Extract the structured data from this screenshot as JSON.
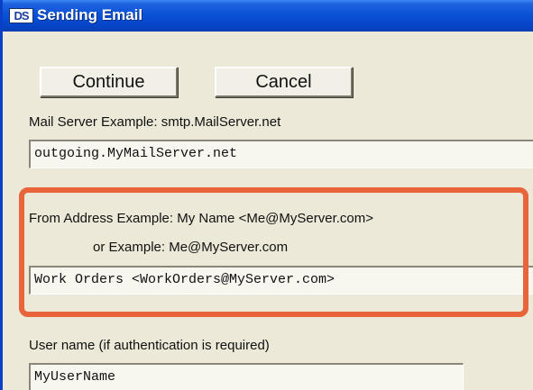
{
  "window": {
    "title": "Sending Email",
    "icon_text": "DS",
    "icon": "app-icon"
  },
  "buttons": {
    "continue_label": "Continue",
    "cancel_label": "Cancel"
  },
  "mail_server": {
    "label": "Mail Server   Example: smtp.MailServer.net",
    "value": "outgoing.MyMailServer.net"
  },
  "from_address": {
    "label": "From Address  Example: My Name <Me@MyServer.com>",
    "label2": "or Example: Me@MyServer.com",
    "value": "Work Orders <WorkOrders@MyServer.com>"
  },
  "user_name": {
    "label": "User name (if authentication is required)",
    "value": "MyUserName"
  },
  "colors": {
    "titlebar": "#0a52d6",
    "window_bg": "#ece9d8",
    "highlight": "#e8643a"
  }
}
